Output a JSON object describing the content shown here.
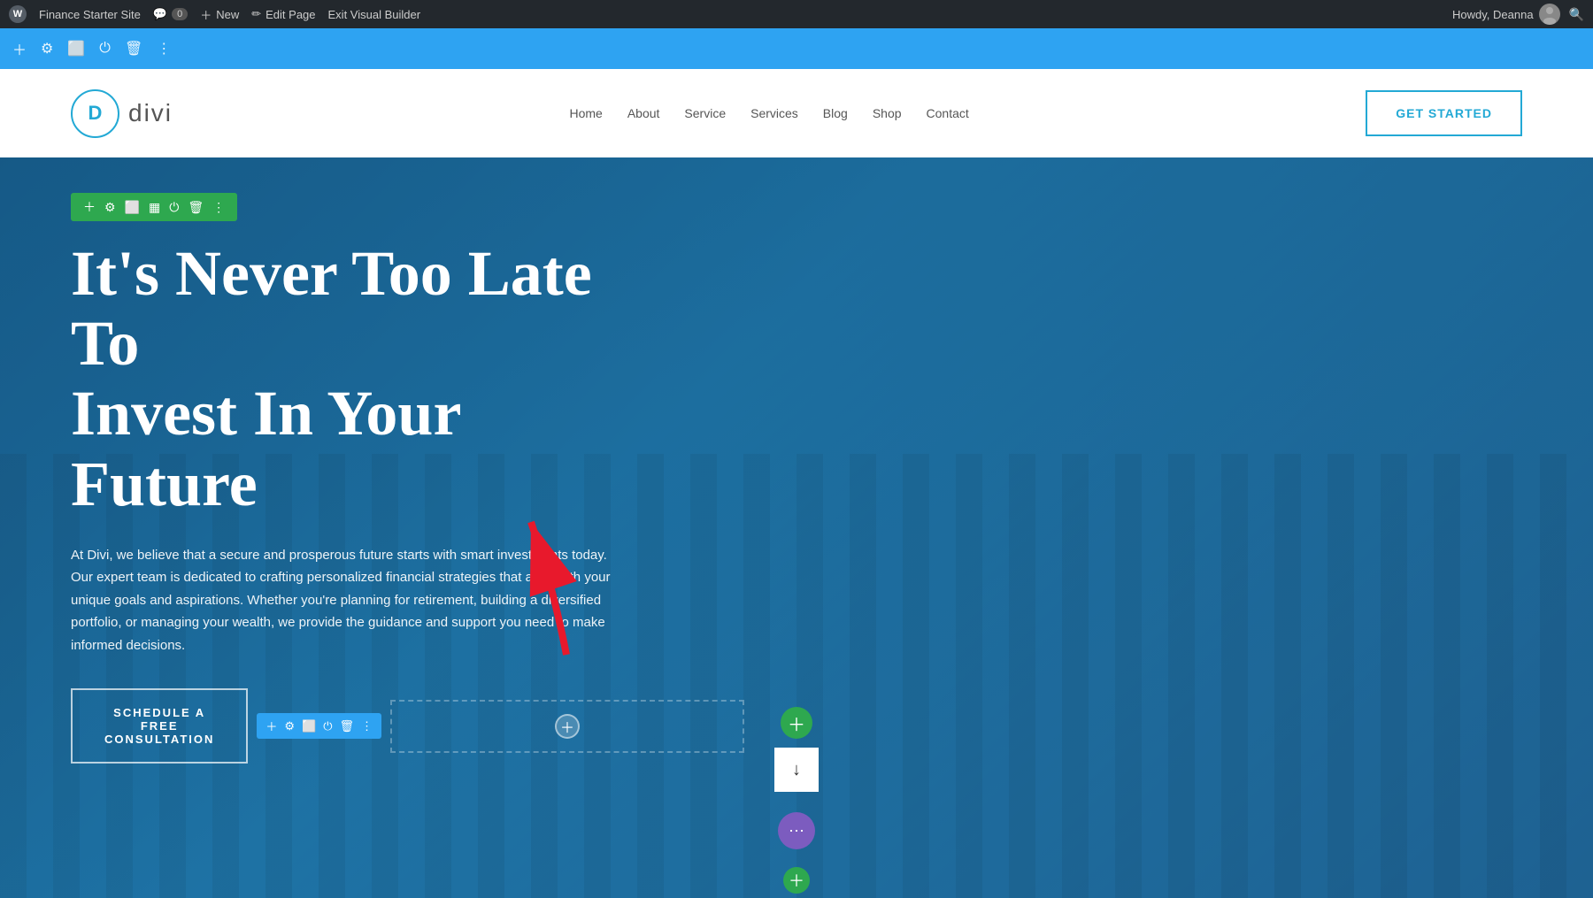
{
  "admin_bar": {
    "site_name": "Finance Starter Site",
    "comments_count": "0",
    "new_label": "New",
    "edit_page_label": "Edit Page",
    "exit_builder_label": "Exit Visual Builder",
    "howdy_text": "Howdy, Deanna"
  },
  "vb_toolbar": {
    "icons": [
      "plus",
      "gear",
      "copy",
      "power",
      "trash",
      "more"
    ]
  },
  "header": {
    "logo_letter": "D",
    "logo_text": "divi",
    "nav_items": [
      "Home",
      "About",
      "Service",
      "Services",
      "Blog",
      "Shop",
      "Contact"
    ],
    "cta_label": "GET STARTED"
  },
  "hero": {
    "row_toolbar_icons": [
      "plus",
      "gear",
      "copy",
      "columns",
      "power",
      "trash",
      "more"
    ],
    "title_line1": "It's Never Too Late To",
    "title_line2": "Invest In Your Future",
    "description": "At Divi, we believe that a secure and prosperous future starts with smart investments today. Our expert team is dedicated to crafting personalized financial strategies that align with your unique goals and aspirations. Whether you're planning for retirement, building a diversified portfolio, or managing your wealth, we provide the guidance and support you need to make informed decisions.",
    "cta_button_label": "SCHEDULE A FREE CONSULTATION",
    "module_toolbar_icons": [
      "plus",
      "gear",
      "copy",
      "power",
      "trash",
      "more"
    ]
  },
  "annotations": {
    "arrow_color": "#e8192c"
  }
}
